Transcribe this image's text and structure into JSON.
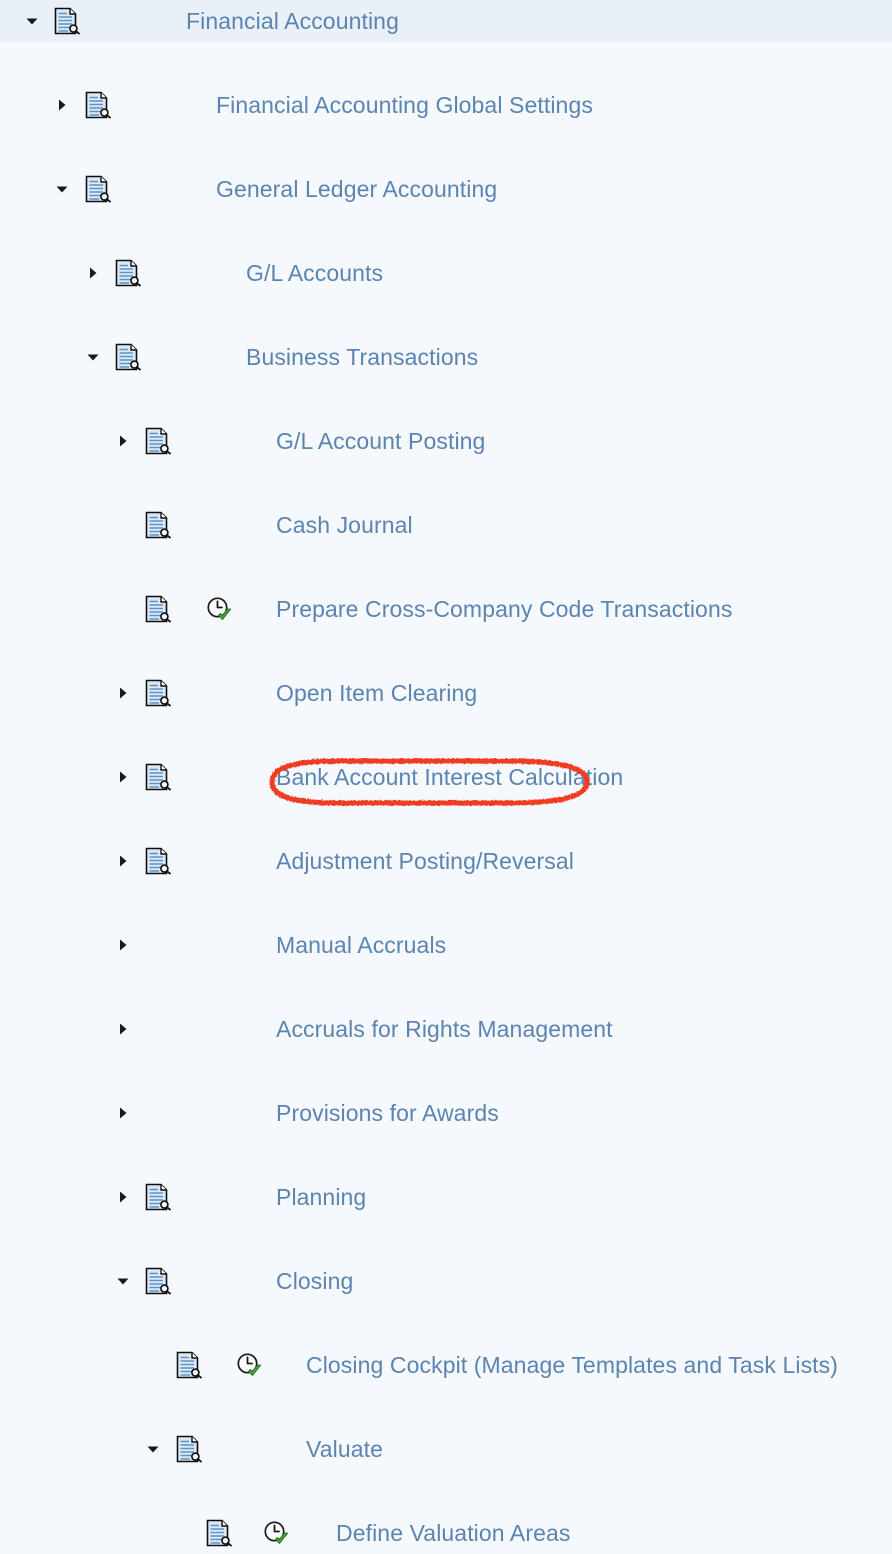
{
  "colors": {
    "page_background": "#f5f8fd",
    "selected_row_background": "#eaf0f7",
    "label_text": "#5b84b1",
    "annotation_stroke": "#f03c20",
    "doc_icon_fill": "#dce9f5",
    "checkmark_green": "#3fa03f"
  },
  "tree": {
    "rows": [
      {
        "label": "Financial Accounting",
        "depth": 0,
        "expander": "expanded",
        "expander_icon": "triangle-down-icon",
        "doc_icon": "img-document-icon",
        "activity_icon": null,
        "selected": true,
        "annotated": false
      },
      {
        "label": "Financial Accounting Global Settings",
        "depth": 1,
        "expander": "collapsed",
        "expander_icon": "triangle-right-icon",
        "doc_icon": "img-document-icon",
        "activity_icon": null,
        "selected": false,
        "annotated": false
      },
      {
        "label": "General Ledger Accounting",
        "depth": 1,
        "expander": "expanded",
        "expander_icon": "triangle-down-icon",
        "doc_icon": "img-document-icon",
        "activity_icon": null,
        "selected": false,
        "annotated": false
      },
      {
        "label": "G/L Accounts",
        "depth": 2,
        "expander": "collapsed",
        "expander_icon": "triangle-right-icon",
        "doc_icon": "img-document-icon",
        "activity_icon": null,
        "selected": false,
        "annotated": false
      },
      {
        "label": "Business Transactions",
        "depth": 2,
        "expander": "expanded",
        "expander_icon": "triangle-down-icon",
        "doc_icon": "img-document-icon",
        "activity_icon": null,
        "selected": false,
        "annotated": false
      },
      {
        "label": "G/L Account Posting",
        "depth": 3,
        "expander": "collapsed",
        "expander_icon": "triangle-right-icon",
        "doc_icon": "img-document-icon",
        "activity_icon": null,
        "selected": false,
        "annotated": false
      },
      {
        "label": "Cash Journal",
        "depth": 3,
        "expander": "none",
        "expander_icon": null,
        "doc_icon": "img-document-icon",
        "activity_icon": null,
        "selected": false,
        "annotated": false
      },
      {
        "label": "Prepare Cross-Company Code Transactions",
        "depth": 3,
        "expander": "none",
        "expander_icon": null,
        "doc_icon": "img-document-icon",
        "activity_icon": "clock-check-icon",
        "selected": false,
        "annotated": false
      },
      {
        "label": "Open Item Clearing",
        "depth": 3,
        "expander": "collapsed",
        "expander_icon": "triangle-right-icon",
        "doc_icon": "img-document-icon",
        "activity_icon": null,
        "selected": false,
        "annotated": false
      },
      {
        "label": "Bank Account Interest Calculation",
        "depth": 3,
        "expander": "collapsed",
        "expander_icon": "triangle-right-icon",
        "doc_icon": "img-document-icon",
        "activity_icon": null,
        "selected": false,
        "annotated": false
      },
      {
        "label": "Adjustment Posting/Reversal",
        "depth": 3,
        "expander": "collapsed",
        "expander_icon": "triangle-right-icon",
        "doc_icon": "img-document-icon",
        "activity_icon": null,
        "selected": false,
        "annotated": false
      },
      {
        "label": "Manual Accruals",
        "depth": 3,
        "expander": "collapsed",
        "expander_icon": "triangle-right-icon",
        "doc_icon": null,
        "activity_icon": null,
        "selected": false,
        "annotated": false
      },
      {
        "label": "Accruals for Rights Management",
        "depth": 3,
        "expander": "collapsed",
        "expander_icon": "triangle-right-icon",
        "doc_icon": null,
        "activity_icon": null,
        "selected": false,
        "annotated": false
      },
      {
        "label": "Provisions for Awards",
        "depth": 3,
        "expander": "collapsed",
        "expander_icon": "triangle-right-icon",
        "doc_icon": null,
        "activity_icon": null,
        "selected": false,
        "annotated": false
      },
      {
        "label": "Planning",
        "depth": 3,
        "expander": "collapsed",
        "expander_icon": "triangle-right-icon",
        "doc_icon": "img-document-icon",
        "activity_icon": null,
        "selected": false,
        "annotated": false
      },
      {
        "label": "Closing",
        "depth": 3,
        "expander": "expanded",
        "expander_icon": "triangle-down-icon",
        "doc_icon": "img-document-icon",
        "activity_icon": null,
        "selected": false,
        "annotated": false
      },
      {
        "label": "Closing Cockpit (Manage Templates and Task Lists)",
        "depth": 4,
        "expander": "none",
        "expander_icon": null,
        "doc_icon": "img-document-icon",
        "activity_icon": "clock-check-icon",
        "selected": false,
        "annotated": false
      },
      {
        "label": "Valuate",
        "depth": 4,
        "expander": "expanded",
        "expander_icon": "triangle-down-icon",
        "doc_icon": "img-document-icon",
        "activity_icon": null,
        "selected": false,
        "annotated": false
      },
      {
        "label": "Define Valuation Areas",
        "depth": 5,
        "expander": "none",
        "expander_icon": null,
        "doc_icon": "img-document-icon",
        "activity_icon": "clock-check-icon",
        "selected": false,
        "annotated": true
      }
    ]
  },
  "annotation": {
    "shape": "hand-drawn-ellipse",
    "target_label": "Define Valuation Areas",
    "color": "#f03c20"
  }
}
